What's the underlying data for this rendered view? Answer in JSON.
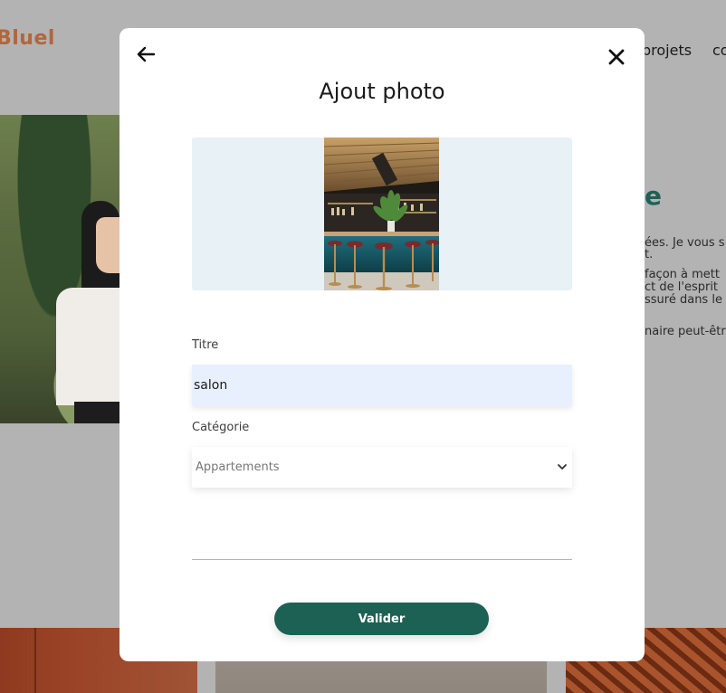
{
  "background": {
    "logo": "Bluel",
    "nav": [
      "projets",
      "co"
    ],
    "about_heading": "e",
    "about_lines": [
      "ées. Je vous s",
      "t.",
      " façon à mett",
      "ct de l'esprit",
      "ssuré dans le",
      "naire peut-êtr"
    ]
  },
  "modal": {
    "back_icon": "arrow-left-icon",
    "close_icon": "close-icon",
    "title": "Ajout photo",
    "form": {
      "title_label": "Titre",
      "title_value": "salon",
      "category_label": "Catégorie",
      "category_selected": "Appartements",
      "submit_label": "Valider"
    }
  },
  "colors": {
    "accent": "#1d6154",
    "logo": "#b1663c",
    "upload_bg": "#e8f1f6",
    "input_bg": "#e8f0fe"
  }
}
